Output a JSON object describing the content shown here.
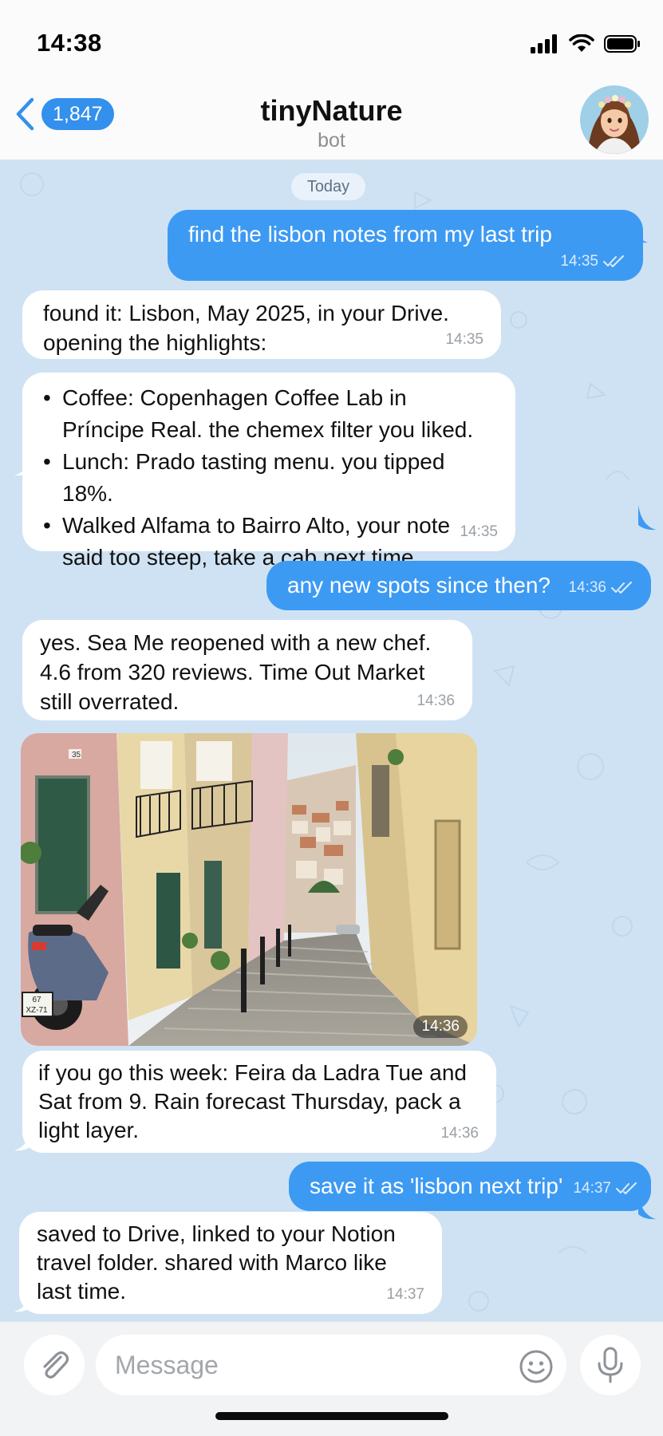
{
  "status_bar": {
    "time": "14:38",
    "icons": [
      "cellular-signal-icon",
      "wifi-icon",
      "battery-icon"
    ]
  },
  "header": {
    "back_count": "1,847",
    "title": "tinyNature",
    "subtitle": "bot"
  },
  "chat": {
    "date_chip": "Today",
    "messages": [
      {
        "dir": "out",
        "text": "find the lisbon notes from my last trip",
        "time": "14:35"
      },
      {
        "dir": "in",
        "lines": [
          "found it: Lisbon, May 2025, in your Drive.",
          "opening the highlights:"
        ],
        "time": "14:35"
      },
      {
        "dir": "in",
        "bullets": [
          [
            "Coffee: Copenhagen Coffee Lab in",
            "Príncipe Real. the chemex filter you liked."
          ],
          [
            "Lunch: Prado tasting menu. you tipped 18%."
          ],
          [
            "Walked Alfama to Bairro Alto, your note",
            "said too steep, take a cab next time."
          ]
        ],
        "time": "14:35"
      },
      {
        "dir": "out",
        "text": "any new spots since then?",
        "time": "14:36"
      },
      {
        "dir": "in",
        "lines": [
          "yes. Sea Me reopened with a new chef.",
          "4.6 from 320 reviews. Time Out Market",
          "still overrated."
        ],
        "time": "14:36"
      },
      {
        "dir": "in",
        "photo": "lisbon-street-photo",
        "plate": [
          "67",
          "XZ-71"
        ],
        "door_number": "35",
        "time": "14:36"
      },
      {
        "dir": "in",
        "lines": [
          "if you go this week: Feira da Ladra Tue and",
          "Sat from 9. Rain forecast Thursday, pack a",
          "light layer."
        ],
        "time": "14:36"
      },
      {
        "dir": "out",
        "text": "save it as 'lisbon next trip'",
        "time": "14:37"
      },
      {
        "dir": "in",
        "lines": [
          "saved to Drive, linked to your Notion",
          "travel folder. shared with Marco like",
          "last time."
        ],
        "time": "14:37"
      }
    ]
  },
  "input": {
    "placeholder": "Message",
    "value": ""
  },
  "colors": {
    "accent": "#3390ec",
    "outgoing_bubble": "#3d9af3",
    "chat_background": "#cfe2f3"
  }
}
